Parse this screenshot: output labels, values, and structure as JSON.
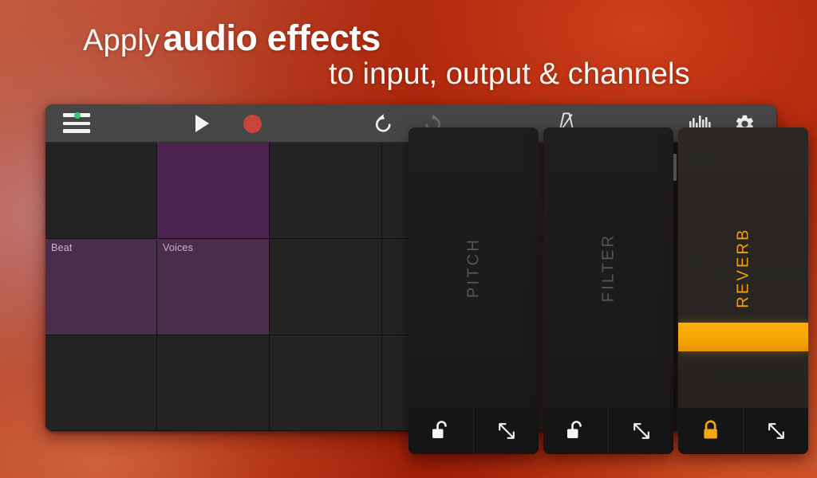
{
  "headline": {
    "line1_light": "Apply",
    "line1_bold": "audio effects",
    "line2": "to input, output & channels"
  },
  "colors": {
    "accent_orange": "#f7a603",
    "record_red": "#c8453a",
    "loop_purple": "#4b2550",
    "waveform_purple": "#b143b5",
    "menu_dot_green": "#2ecc71",
    "background_red": "#ae2f13"
  },
  "app": {
    "toolbar": {
      "items": [
        {
          "name": "menu",
          "label": "Menu",
          "icon": "hamburger-icon",
          "state": "has-notification"
        },
        {
          "name": "play",
          "label": "Play",
          "icon": "play-icon",
          "state": "enabled"
        },
        {
          "name": "record",
          "label": "Record",
          "icon": "record-icon",
          "state": "enabled"
        },
        {
          "name": "undo",
          "label": "Undo",
          "icon": "undo-icon",
          "state": "enabled"
        },
        {
          "name": "redo",
          "label": "Redo",
          "icon": "redo-icon",
          "state": "disabled"
        },
        {
          "name": "metronome",
          "label": "Metronome",
          "icon": "metronome-icon",
          "state": "enabled"
        },
        {
          "name": "levels",
          "label": "Levels",
          "icon": "levels-icon",
          "state": "enabled"
        },
        {
          "name": "settings",
          "label": "Settings",
          "icon": "gear-icon",
          "state": "enabled"
        }
      ]
    },
    "grid": {
      "rows": 3,
      "cols": 5,
      "cells": [
        {
          "row": 0,
          "col": 0,
          "label": "",
          "filled": false,
          "art": "none"
        },
        {
          "row": 0,
          "col": 1,
          "label": "",
          "filled": true,
          "art": "ring-sparse"
        },
        {
          "row": 0,
          "col": 2,
          "label": "",
          "filled": false,
          "art": "none"
        },
        {
          "row": 0,
          "col": 3,
          "label": "",
          "filled": false,
          "art": "none"
        },
        {
          "row": 0,
          "col": 4,
          "label": "",
          "filled": false,
          "art": "none"
        },
        {
          "row": 1,
          "col": 0,
          "label": "Beat",
          "filled": true,
          "art": "ring-crosshair"
        },
        {
          "row": 1,
          "col": 1,
          "label": "Voices",
          "filled": true,
          "art": "ring-dense"
        },
        {
          "row": 1,
          "col": 2,
          "label": "",
          "filled": false,
          "art": "none"
        },
        {
          "row": 1,
          "col": 3,
          "label": "",
          "filled": false,
          "art": "none"
        },
        {
          "row": 1,
          "col": 4,
          "label": "",
          "filled": false,
          "art": "none"
        },
        {
          "row": 2,
          "col": 0,
          "label": "",
          "filled": false,
          "art": "none"
        },
        {
          "row": 2,
          "col": 1,
          "label": "",
          "filled": false,
          "art": "none"
        },
        {
          "row": 2,
          "col": 2,
          "label": "",
          "filled": false,
          "art": "none"
        },
        {
          "row": 2,
          "col": 3,
          "label": "",
          "filled": false,
          "art": "none"
        },
        {
          "row": 2,
          "col": 4,
          "label": "",
          "filled": false,
          "art": "none"
        }
      ]
    },
    "scrollbar": {
      "orientation": "vertical",
      "thumb_position_pct": 4,
      "thumb_size_pct": 9
    }
  },
  "effect_panels": [
    {
      "title": "PITCH",
      "active": false,
      "locked": false,
      "lock_label": "Unlocked",
      "expand_label": "Expand",
      "slider_value_pct": 0
    },
    {
      "title": "FILTER",
      "active": false,
      "locked": false,
      "lock_label": "Unlocked",
      "expand_label": "Expand",
      "slider_value_pct": 0
    },
    {
      "title": "REVERB",
      "active": true,
      "locked": true,
      "lock_label": "Locked",
      "expand_label": "Expand",
      "slider_value_pct": 72
    }
  ]
}
